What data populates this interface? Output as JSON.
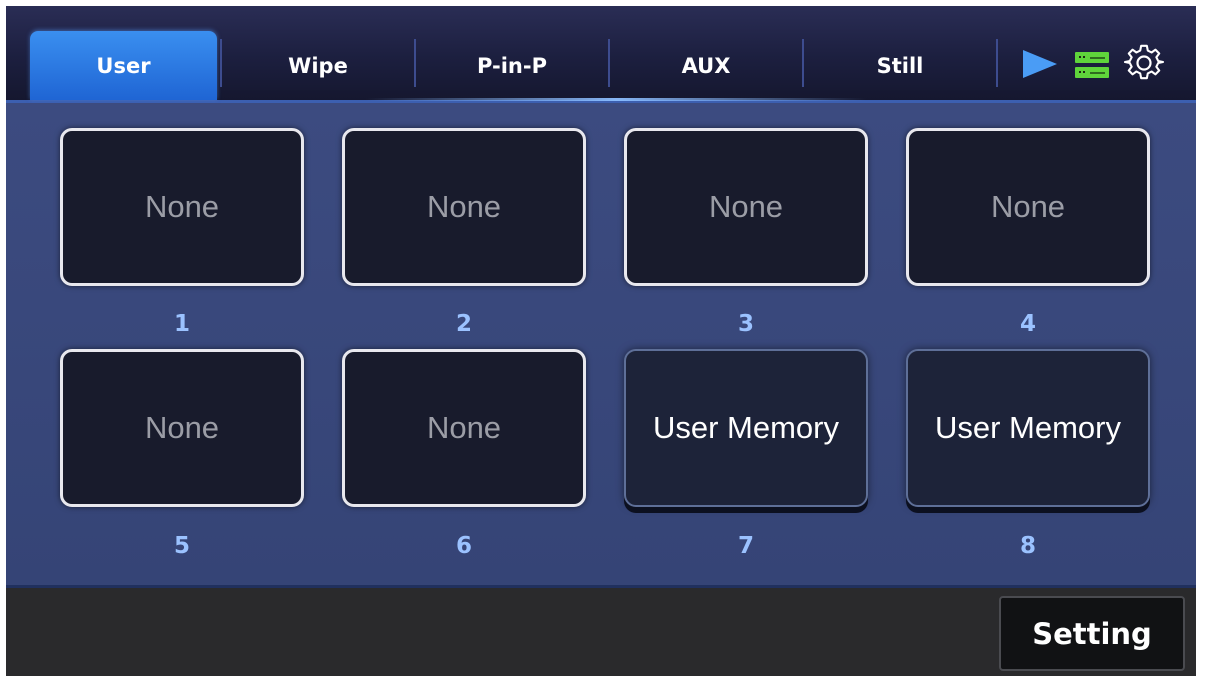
{
  "tabs": [
    {
      "label": "User",
      "active": true
    },
    {
      "label": "Wipe",
      "active": false
    },
    {
      "label": "P-in-P",
      "active": false
    },
    {
      "label": "AUX",
      "active": false
    },
    {
      "label": "Still",
      "active": false
    }
  ],
  "toolbar_icons": [
    "play-icon",
    "server-status-icon",
    "gear-icon"
  ],
  "slots": [
    {
      "number": "1",
      "label": "None",
      "state": "empty"
    },
    {
      "number": "2",
      "label": "None",
      "state": "empty"
    },
    {
      "number": "3",
      "label": "None",
      "state": "empty"
    },
    {
      "number": "4",
      "label": "None",
      "state": "empty"
    },
    {
      "number": "5",
      "label": "None",
      "state": "empty"
    },
    {
      "number": "6",
      "label": "None",
      "state": "empty"
    },
    {
      "number": "7",
      "label": "User Memory",
      "state": "filled"
    },
    {
      "number": "8",
      "label": "User Memory",
      "state": "filled"
    }
  ],
  "footer": {
    "setting_label": "Setting"
  },
  "colors": {
    "active_tab": "#2a7ae8",
    "play_icon": "#4a9cf5",
    "status_icon": "#5fd43b",
    "slot_number": "#9bc2ff"
  }
}
